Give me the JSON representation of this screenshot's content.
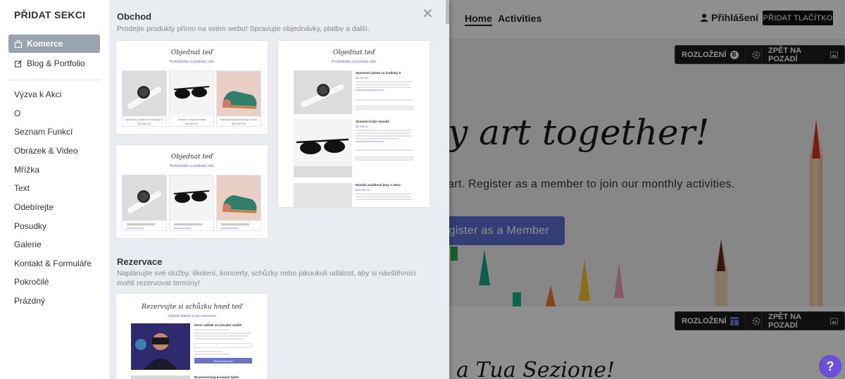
{
  "site": {
    "nav": {
      "home": "Home",
      "activities": "Activities"
    },
    "login_label": "Přihlášení",
    "add_button_label": "PŘIDAT TLAČÍTKO",
    "hero": {
      "title": "y art together!",
      "subtitle": "art. Register as a member to join our monthly activities.",
      "cta_label": "gister as a Member"
    },
    "controls": {
      "layout_label": "ROZLOŽENÍ",
      "layout_badge": "B",
      "background_label": "ZPĚT NA POZADÍ"
    },
    "section2_title": "a Tua Sezione!",
    "help_label": "?"
  },
  "panel": {
    "title": "PŘIDAT SEKCI",
    "primary_categories": [
      {
        "label": "Komerce",
        "icon": "shopping-bag-icon",
        "active": true
      },
      {
        "label": "Blog & Portfolio",
        "icon": "edit-icon",
        "active": false
      }
    ],
    "categories": [
      "Výzva k Akci",
      "O",
      "Seznam Funkcí",
      "Obrázek & Video",
      "Mřížka",
      "Text",
      "Odebírejte",
      "Posudky",
      "Galerie",
      "Kontakt & Formuláře",
      "Pokročilé",
      "Prázdný"
    ],
    "sections": [
      {
        "title": "Obchod",
        "description": "Prodejte produkty přímo na svém webu! Spravujte objednávky, platby a další."
      },
      {
        "title": "Rezervace",
        "description": "Naplánujte své služby, školení, koncerty, schůzky nebo jakoukoli událost, aby si návštěvníci mohli rezervovat termíny!"
      }
    ],
    "templates": {
      "order_title": "Objednat teď",
      "order_subtitle": "Prohlédněte si produkty níže",
      "booking_title": "Rezervujte si schůzku hned teď",
      "booking_subtitle": "Vyberte datum a čas rezervace",
      "products": [
        {
          "name": "Sportovní pásek na hodinky S",
          "price": "$9,999.00"
        },
        {
          "name": "Sluneční brýle Senské",
          "price": "$4,999.00"
        },
        {
          "name": "Pánská značková boty s obuv",
          "price": "$78,999.00"
        }
      ],
      "booking_item": "Herní zážitek ve virtuální realitě",
      "booking_button": "Rezervovat teď",
      "booking_item2": "Brainstorming kreativní týden"
    }
  }
}
